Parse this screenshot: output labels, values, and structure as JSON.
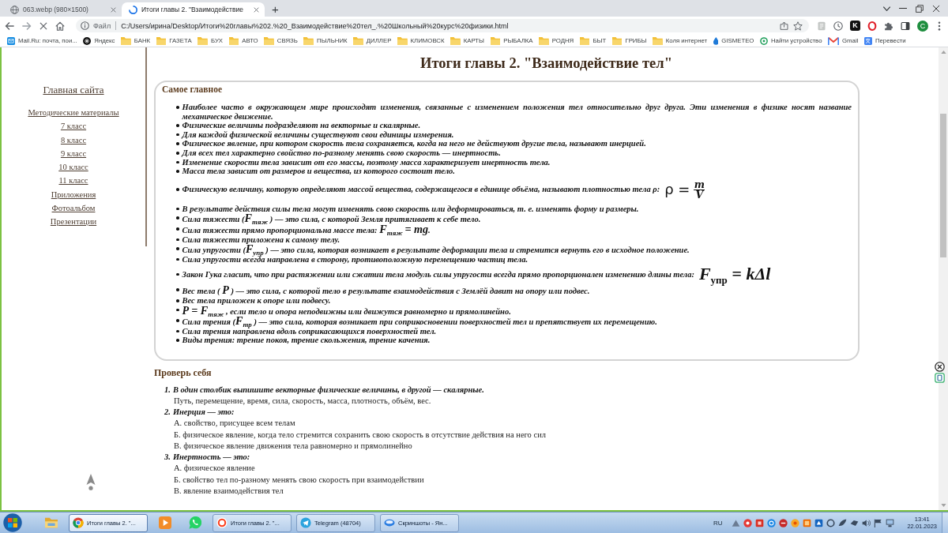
{
  "browser": {
    "tabs": [
      {
        "title": "063.webp (980×1500)",
        "selected": false,
        "loading": false
      },
      {
        "title": "Итоги главы 2. \"Взаимодействие",
        "selected": true,
        "loading": true
      }
    ],
    "new_tab": "+",
    "address": {
      "label": "Файл",
      "url": "C:/Users/ирина/Desktop/Итоги%20главы%202.%20_Взаимодействие%20тел_.%20Школьный%20курс%20физики.html"
    },
    "extension_letter": "K",
    "profile_initial": "C",
    "bookmarks": [
      {
        "label": "Mail.Ru: почта, пои...",
        "kind": "mail"
      },
      {
        "label": "Яндекс",
        "kind": "search"
      },
      {
        "label": "БАНК",
        "kind": "folder"
      },
      {
        "label": "ГАЗЕТА",
        "kind": "folder"
      },
      {
        "label": "БУХ",
        "kind": "folder"
      },
      {
        "label": "АВТО",
        "kind": "folder"
      },
      {
        "label": "СВЯЗЬ",
        "kind": "folder"
      },
      {
        "label": "ПЫЛЬНИК",
        "kind": "folder"
      },
      {
        "label": "ДИЛЛЕР",
        "kind": "folder"
      },
      {
        "label": "КЛИМОВСК",
        "kind": "folder"
      },
      {
        "label": "КАРТЫ",
        "kind": "folder"
      },
      {
        "label": "РЫБАЛКА",
        "kind": "folder"
      },
      {
        "label": "РОДНЯ",
        "kind": "folder"
      },
      {
        "label": "БЫТ",
        "kind": "folder"
      },
      {
        "label": "ГРИБЫ",
        "kind": "folder"
      },
      {
        "label": "Коля интернет",
        "kind": "folder"
      },
      {
        "label": "GISMETEO",
        "kind": "weather"
      },
      {
        "label": "Найти устройство",
        "kind": "locator"
      },
      {
        "label": "Gmail",
        "kind": "gmail"
      },
      {
        "label": "Перевести",
        "kind": "translate"
      }
    ]
  },
  "sidebar": {
    "home_link": "Главная сайта",
    "links": [
      "Методические материалы",
      "7 класс",
      "8 класс",
      "9 класс",
      "10 класс",
      "11 класс",
      "Приложения",
      "Фотоальбом",
      "Презентации"
    ]
  },
  "article": {
    "title": "Итоги главы 2. \"Взаимодействие тел\"",
    "summary": {
      "heading": "Самое главное",
      "items": [
        {
          "text": "Наиболее часто в окружающем мире происходят изменения, связанные с изменением положения тел относительно друг друга. Эти изменения в физике носят название механическое движение."
        },
        {
          "text": "Физические величины подразделяют на векторные и скалярные."
        },
        {
          "text": "Для каждой физической величины существуют свои единицы измерения."
        },
        {
          "text": "Физическое явление, при котором скорость тела сохраняется, когда на него не действуют другие тела, называют инерцией."
        },
        {
          "text": "Для всех тел характерно свойство по-разному менять свою скорость — инертность."
        },
        {
          "text": "Изменение скорости тела зависит от его массы, поэтому масса характеризует инертность тела."
        },
        {
          "text": "Масса тела зависит от размеров и вещества, из которого состоит тело."
        },
        {
          "text": "Физическую величину, которую определяют массой вещества, содержащегося в единице объёма, называют плотностью тела ρ:",
          "formula": {
            "kind": "fraction",
            "lhs": "ρ =",
            "numerator": "m",
            "denominator": "V"
          }
        },
        {
          "text": "В результате действия силы тела могут изменять свою скорость или деформироваться, т. е. изменять форму и размеры."
        },
        {
          "text": "Сила тяжести (**F**$_{тяж}$ ) — это сила, с которой Земля притягивает к себе тело."
        },
        {
          "text": "Сила тяжести прямо пропорциональна массе тела: **F**$_{тяж}$ **= mg**."
        },
        {
          "text": "Сила тяжести приложена к самому телу."
        },
        {
          "text": "Сила упругости (**F**$_{упр}$ ) — это сила, которая возникает в результате деформации тела и стремится вернуть его в исходное положение."
        },
        {
          "text": "Сила упругости всегда направлена в сторону, противоположную перемещению частиц тела."
        },
        {
          "text": "Закон Гука гласит, что при растяжении или сжатии тела модуль силы упругости всегда прямо пропорционален изменению длины тела:",
          "formula": {
            "kind": "equation",
            "text": "F$_{упр}$ = kΔl"
          }
        },
        {
          "text": "Вес тела ( **P** ) — это сила, с которой тело в результате взаимодействия с Землёй давит на опору или подвес."
        },
        {
          "text": "Вес тела приложен к опоре или подвесу."
        },
        {
          "text": "**P = F**$_{тяж}$ , если тело и опора неподвижны или движутся равномерно и прямолинейно."
        },
        {
          "text": "Сила трения (**F**$_{тр}$ ) — это сила, которая возникает при соприкосновении поверхностей тел и препятствует их перемещению."
        },
        {
          "text": "Сила трения направлена вдоль соприкасающихся поверхностей тел."
        },
        {
          "text": "Виды трения: трение покоя, трение скольжения, трение качения."
        }
      ]
    },
    "quiz": {
      "heading": "Проверь себя",
      "questions": [
        {
          "number": "1.",
          "text": "В один столбик выпишите векторные физические величины, в другой — скалярные.",
          "answers": [
            "Путь, перемещение, время, сила, скорость, масса, плотность, объём, вес."
          ]
        },
        {
          "number": "2.",
          "text": "Инерция — это:",
          "answers": [
            "А. свойство, присущее всем телам",
            "Б. физическое явление, когда тело стремится сохранить свою скорость в отсутствие действия на него сил",
            "В. физическое явление движения тела равномерно и прямолинейно"
          ]
        },
        {
          "number": "3.",
          "text": "Инертность — это:",
          "answers": [
            "А. физическое явление",
            "Б. свойство тел по-разному менять свою скорость при взаимодействии",
            "В. явление взаимодействия тел"
          ]
        }
      ]
    }
  },
  "taskbar": {
    "items": [
      {
        "kind": "explorer",
        "selected": false
      },
      {
        "kind": "chrome",
        "title": "Итоги главы 2. \"...",
        "selected": true
      },
      {
        "kind": "player",
        "selected": false
      },
      {
        "kind": "whatsapp",
        "selected": false
      },
      {
        "kind": "yandex",
        "title": "Итоги главы 2. \"...",
        "selected": false
      },
      {
        "kind": "telegram",
        "title": "Telegram (48704)",
        "selected": false
      },
      {
        "kind": "screenshots",
        "title": "Скриншоты - Ян...",
        "selected": false
      }
    ],
    "language": "RU",
    "time": "13:41",
    "date": "22.01.2023"
  }
}
